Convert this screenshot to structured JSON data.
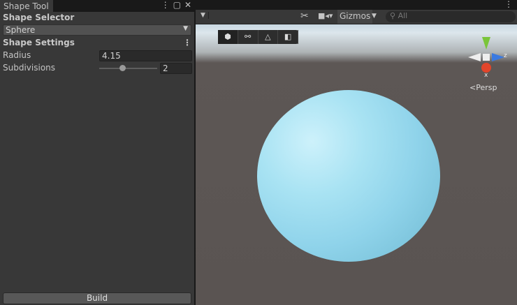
{
  "panel": {
    "tab_title": "Shape Tool",
    "shape_selector_label": "Shape Selector",
    "shape_value": "Sphere",
    "shape_settings_label": "Shape Settings",
    "radius_label": "Radius",
    "radius_value": "4.15",
    "subdivisions_label": "Subdivisions",
    "subdivisions_value": "2",
    "subdivisions_fraction": 0.4,
    "build_label": "Build"
  },
  "scene": {
    "gizmos_label": "Gizmos",
    "search_placeholder": "All",
    "projection_label": "Persp",
    "axis_x": "x",
    "axis_z": "z",
    "sphere_color": "#8fd3ea"
  }
}
